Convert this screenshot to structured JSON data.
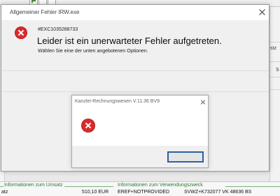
{
  "main_dialog": {
    "title": "Allgemeiner Fehler  IRW.exe",
    "error_code": "#EXC1035288733",
    "heading": "Leider ist ein unerwarteter Fehler aufgetreten.",
    "subtext": "Wählen Sie eine der unten angebotenen Optionen."
  },
  "inner_dialog": {
    "title": "Kanzlei-Rechnungswesen V.11.36 BV9",
    "button_label": ""
  },
  "background": {
    "right_truncated_1": "stz",
    "right_truncated_2": "S",
    "section_left_title": "Informationen zum Umsatz",
    "section_right_title": "Informationen zum Verwendungszweck",
    "row": {
      "col1": "atz",
      "amount": "510,10 EUR",
      "ref": "EREF+NOTPROVIDED",
      "purpose": "SVWZ+K732077 VK 48636 BS"
    }
  },
  "colors": {
    "error_red": "#d92b2b",
    "focus_blue": "#2b5fa8",
    "section_green": "#2a7a2a"
  }
}
